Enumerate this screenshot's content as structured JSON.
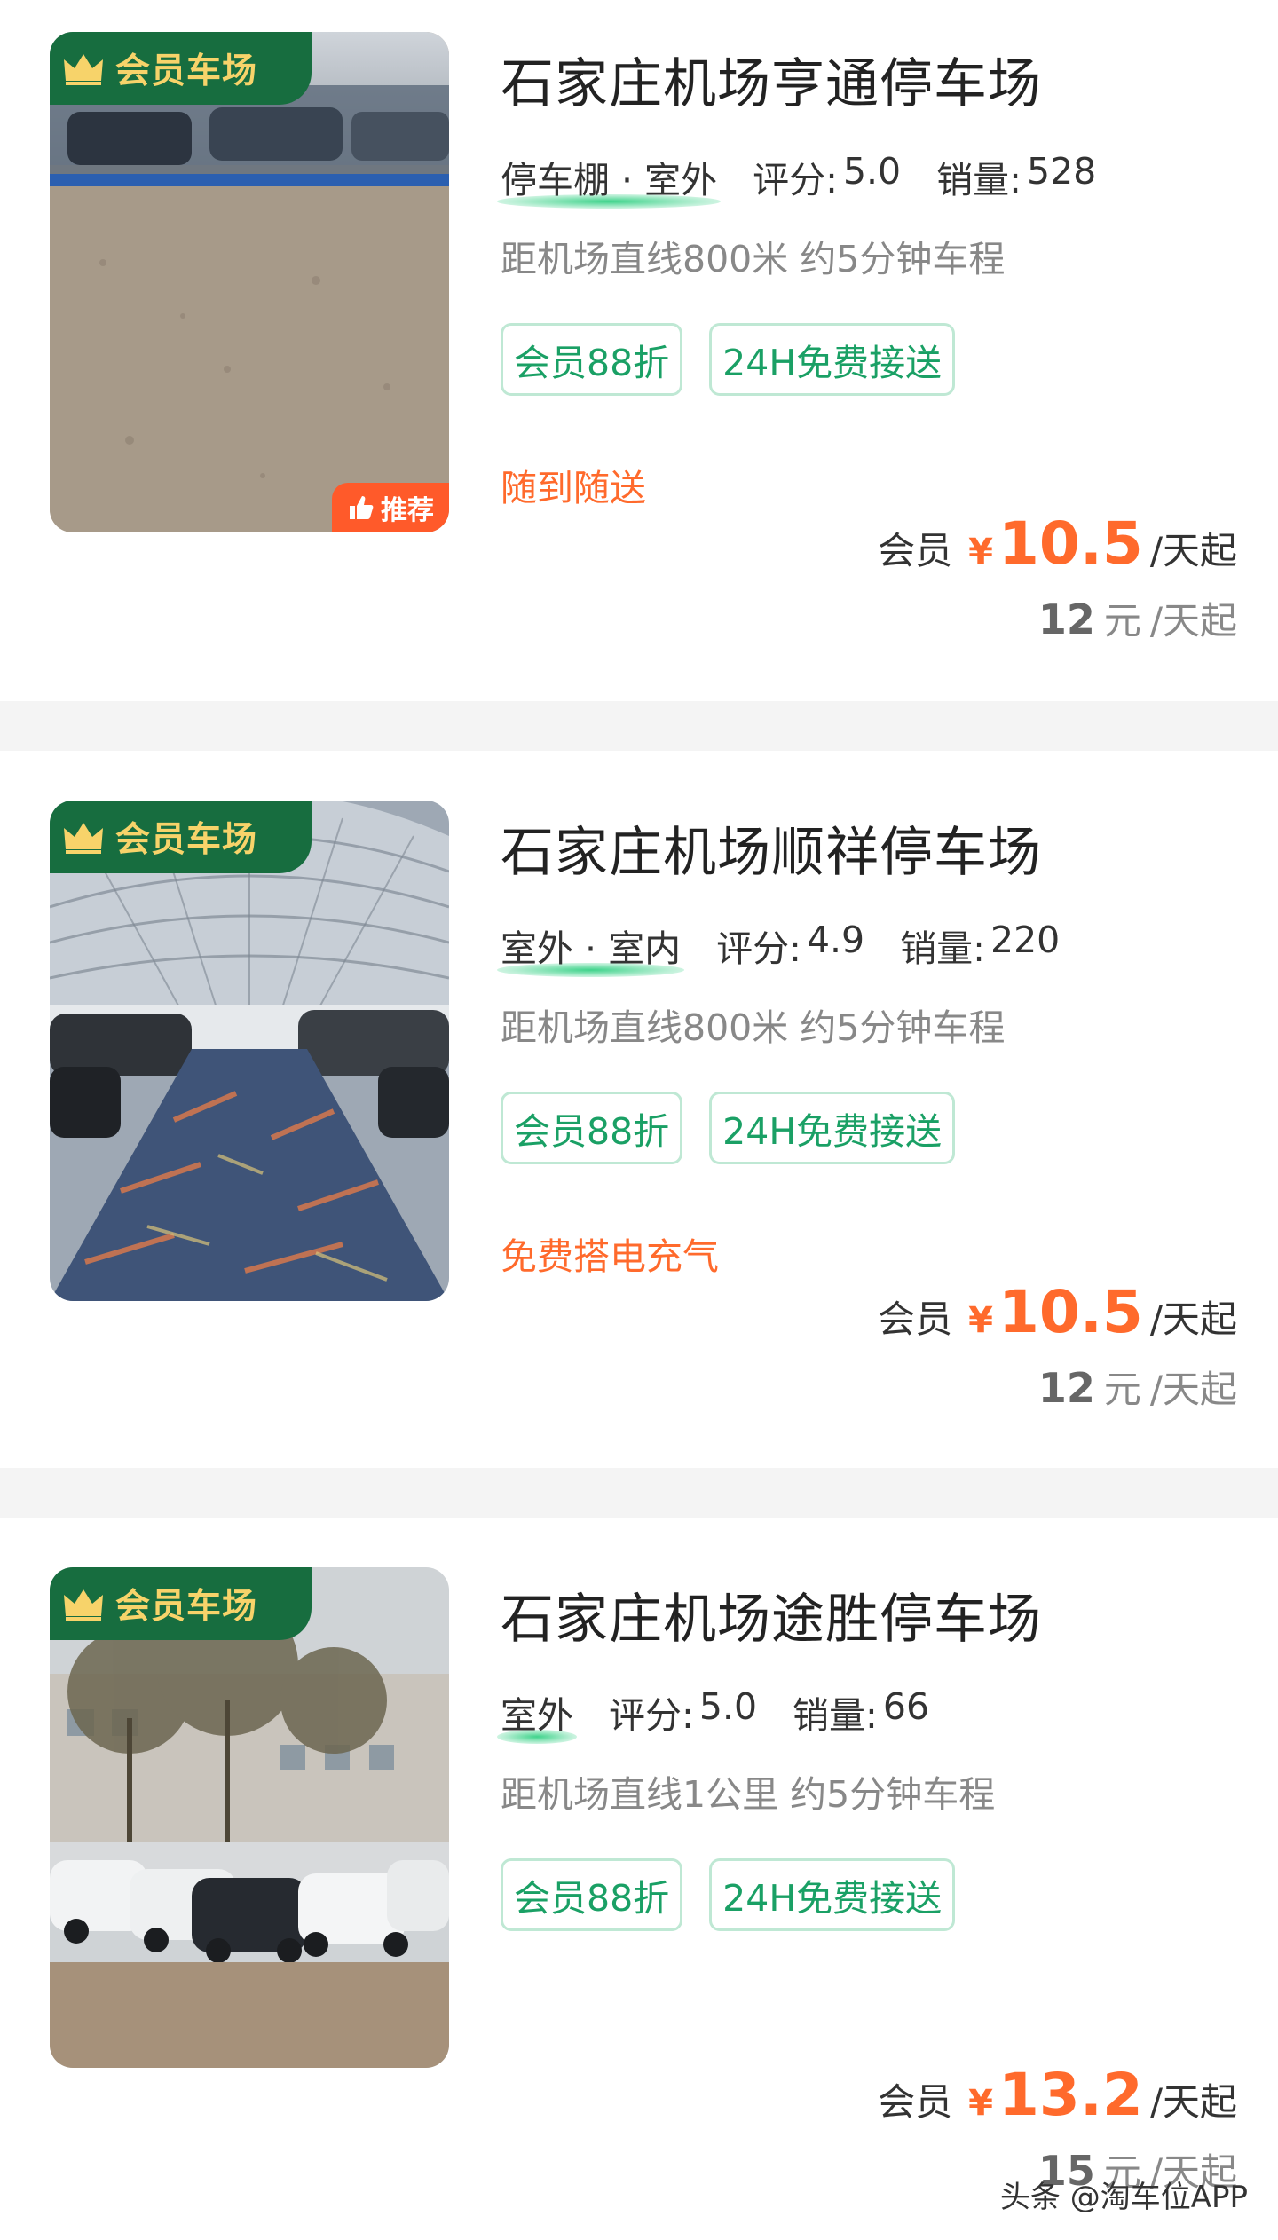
{
  "lots": [
    {
      "name": "石家庄机场亨通停车场",
      "badge": "会员车场",
      "recommend": "推荐",
      "tag": "停车棚 · 室外",
      "rating_label": "评分:",
      "rating": "5.0",
      "sales_label": "销量:",
      "sales": "528",
      "distance": "距机场直线800米 约5分钟车程",
      "pills": [
        "会员88折",
        "24H免费接送"
      ],
      "perk": "随到随送",
      "member_label": "会员",
      "currency": "¥",
      "member_price": "10.5",
      "price_unit": "/天起",
      "orig_price": "12",
      "orig_currency": "元",
      "orig_unit": "/天起"
    },
    {
      "name": "石家庄机场顺祥停车场",
      "badge": "会员车场",
      "tag": "室外 · 室内",
      "rating_label": "评分:",
      "rating": "4.9",
      "sales_label": "销量:",
      "sales": "220",
      "distance": "距机场直线800米 约5分钟车程",
      "pills": [
        "会员88折",
        "24H免费接送"
      ],
      "perk": "免费搭电充气",
      "member_label": "会员",
      "currency": "¥",
      "member_price": "10.5",
      "price_unit": "/天起",
      "orig_price": "12",
      "orig_currency": "元",
      "orig_unit": "/天起"
    },
    {
      "name": "石家庄机场途胜停车场",
      "badge": "会员车场",
      "tag": "室外",
      "rating_label": "评分:",
      "rating": "5.0",
      "sales_label": "销量:",
      "sales": "66",
      "distance": "距机场直线1公里 约5分钟车程",
      "pills": [
        "会员88折",
        "24H免费接送"
      ],
      "perk": "",
      "member_label": "会员",
      "currency": "¥",
      "member_price": "13.2",
      "price_unit": "/天起",
      "orig_price": "15",
      "orig_currency": "元",
      "orig_unit": "/天起"
    }
  ],
  "watermark": "头条 @淘车位APP",
  "colors": {
    "accent": "#ff6a2c",
    "green": "#1aa065",
    "badge_bg": "#176d3f",
    "badge_text": "#f7d36a"
  }
}
